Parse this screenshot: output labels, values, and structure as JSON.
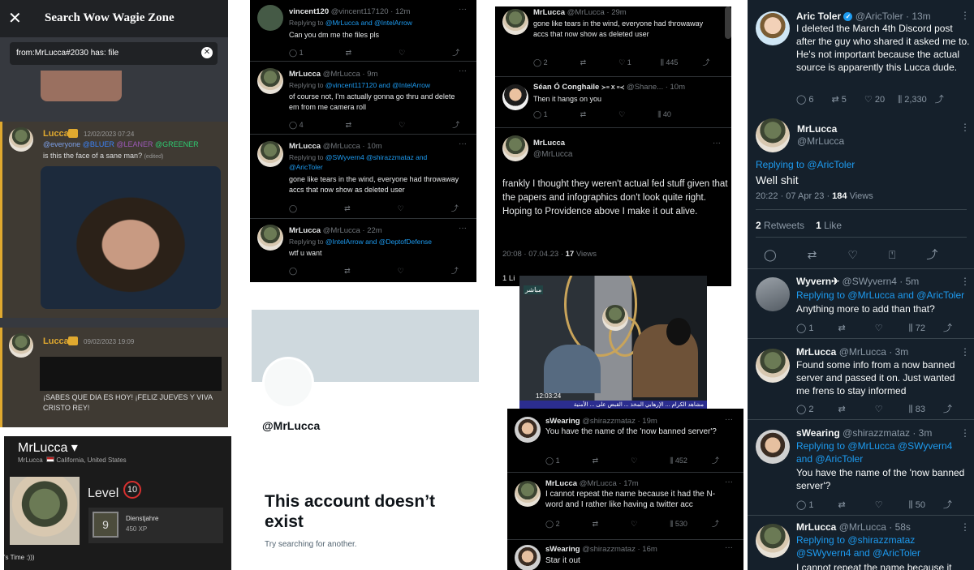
{
  "discord": {
    "title": "Search Wow Wagie Zone",
    "search_query": "from:MrLucca#2030 has: file",
    "msg1": {
      "name": "Lucca",
      "time": "12/02/2023 07:24",
      "m_everyone": "@everyone",
      "m_bluer": "@BLUER",
      "m_leaner": "@LEANER",
      "m_greener": "@GREENER",
      "text": "is this the face of a sane man?",
      "edited": "(edited)"
    },
    "msg2": {
      "name": "Lucca",
      "time": "09/02/2023 19:09",
      "text": "¡SABES QUE DIA ES HOY! ¡FELIZ JUEVES Y VIVA CRISTO REY!"
    }
  },
  "steam": {
    "name": "MrLucca",
    "sub": "MrLucca",
    "location": "California, United States",
    "level_label": "Level",
    "level": "10",
    "badge_icon": "9",
    "badge_line1": "Dienstjahre",
    "badge_line2": "450 XP",
    "bottom_text": "'s Time :)))"
  },
  "thread1": [
    {
      "name": "vincent120",
      "handle": "@vincent117120 · 12m",
      "reply_prefix": "Replying to",
      "reply_to": "@MrLucca and @IntelArrow",
      "text": "Can you dm me the files pls",
      "replies": "1"
    },
    {
      "name": "MrLucca",
      "handle": "@MrLucca · 9m",
      "reply_prefix": "Replying to",
      "reply_to": "@vincent117120 and @IntelArrow",
      "text": "of course not, I'm actually gonna go thru and delete em from me camera roll",
      "replies": "4"
    },
    {
      "name": "MrLucca",
      "handle": "@MrLucca · 10m",
      "reply_prefix": "Replying to",
      "reply_to": "@SWyvern4 @shirazzmataz and @AricToler",
      "text": "gone like tears in the wind, everyone had throwaway accs that now show as deleted user"
    },
    {
      "name": "MrLucca",
      "handle": "@MrLucca · 22m",
      "reply_prefix": "Replying to",
      "reply_to": "@IntelArrow and @DeptofDefense",
      "text": "wtf u want"
    }
  ],
  "profile": {
    "handle": "@MrLucca",
    "headline": "This account doesn’t exist",
    "sub": "Try searching for another."
  },
  "thread2": {
    "t1": {
      "name": "MrLucca",
      "handle": "@MrLucca · 29m",
      "text": "gone like tears in the wind, everyone had throwaway accs that now show as deleted user",
      "replies": "2",
      "likes": "1",
      "views": "445"
    },
    "t2": {
      "name": "Séan Ó Conghaile",
      "name_suffix": "≻≡ X ≡≺",
      "handle": "@Shane... · 10m",
      "text": "Then it hangs on you",
      "replies": "1",
      "views": "40"
    },
    "t3": {
      "name": "MrLucca",
      "handle": "@MrLucca",
      "text": "frankly I thought they weren't actual fed stuff given that the papers and infographics don't look quite right. Hoping to Providence above I make it out alive.",
      "meta_time": "20:08 · 07.04.23 · ",
      "meta_views": "17",
      "meta_views_label": "Views",
      "likes_partial": "1 Li"
    }
  },
  "video": {
    "time": "12:03:24",
    "channel": "مباشر",
    "band": "مشاهد الكرام ... الإرهابي المخذ ... القبض على ... الأمنية"
  },
  "thread3": [
    {
      "name": "sWearing",
      "handle": "@shirazzmataz · 19m",
      "text": "You have the name of the 'now banned server'?",
      "replies": "1",
      "views": "452"
    },
    {
      "name": "MrLucca",
      "handle": "@MrLucca · 17m",
      "text": "I cannot repeat the name because it had the N-word and I rather like having a twitter acc",
      "replies": "2",
      "views": "530"
    },
    {
      "name": "sWearing",
      "handle": "@shirazzmataz · 16m",
      "text": "Star it out"
    }
  ],
  "right": {
    "t1": {
      "name": "Aric Toler",
      "handle": "@AricToler · 13m",
      "text": "I deleted the March 4th Discord post after the guy who shared it asked me to. He's not important because the actual source is apparently this Lucca dude.",
      "replies": "6",
      "retweets": "5",
      "likes": "20",
      "views": "2,330"
    },
    "main": {
      "name": "MrLucca",
      "handle": "@MrLucca",
      "reply_prefix": "Replying to",
      "reply_to": "@AricToler",
      "text": "Well shit",
      "time": "20:22 · 07 Apr 23 · ",
      "views": "184",
      "views_label": "Views",
      "retweets": "2",
      "retweets_label": "Retweets",
      "likes": "1",
      "likes_label": "Like"
    },
    "r1": {
      "name": "Wyvern✈",
      "handle": "@SWyvern4 · 5m",
      "reply_prefix": "Replying to",
      "reply_to": "@MrLucca and @AricToler",
      "text": "Anything more to add than that?",
      "replies": "1",
      "views": "72"
    },
    "r2": {
      "name": "MrLucca",
      "handle": "@MrLucca · 3m",
      "text": "Found some info from a now banned server and passed it on. Just wanted me frens to stay informed",
      "replies": "2",
      "views": "83"
    },
    "r3": {
      "name": "sWearing",
      "handle": "@shirazzmataz · 3m",
      "reply_prefix": "Replying to",
      "reply_to": "@MrLucca @SWyvern4 and @AricToler",
      "text": "You have the name of the 'now banned server'?",
      "replies": "1",
      "views": "50"
    },
    "r4": {
      "name": "MrLucca",
      "handle": "@MrLucca · 58s",
      "reply_prefix": "Replying to",
      "reply_to": "@shirazzmataz @SWyvern4 and @AricToler",
      "text": "I cannot repeat the name because it"
    }
  }
}
